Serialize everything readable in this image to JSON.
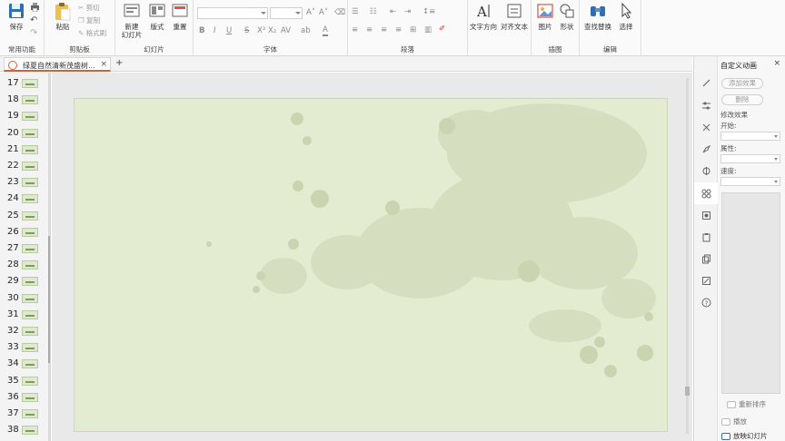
{
  "ribbon": {
    "groups": {
      "common": "常用功能",
      "clipboard": "剪贴板",
      "slides": "幻灯片",
      "font": "字体",
      "paragraph": "段落",
      "illustration": "插图",
      "edit": "编辑"
    },
    "buttons": {
      "save": "保存",
      "paste": "粘贴",
      "cut": "剪切",
      "copy": "复制",
      "format_painter": "格式刷",
      "new_slide_1": "新建",
      "new_slide_2": "幻灯片",
      "layout": "版式",
      "reset": "重置",
      "text_direction": "文字方向",
      "align_text": "对齐文本",
      "picture": "图片",
      "shape": "形状",
      "find_replace": "查找替换",
      "select": "选择"
    },
    "font_buttons": [
      "B",
      "I",
      "U",
      "S",
      "A"
    ],
    "font_size_buttons": [
      "A˄",
      "A˅"
    ]
  },
  "tabs": {
    "document_title": "绿夏自然清新茂盛树...",
    "close": "×",
    "add": "+"
  },
  "thumbnails": [
    "17",
    "18",
    "19",
    "20",
    "21",
    "22",
    "23",
    "24",
    "25",
    "26",
    "27",
    "28",
    "29",
    "30",
    "31",
    "32",
    "33",
    "34",
    "35",
    "36",
    "37",
    "38"
  ],
  "pane": {
    "title": "自定义动画",
    "close": "×",
    "add_effect": "添加效果",
    "delete": "删除",
    "modify": "修改效果",
    "start": "开始:",
    "property": "属性:",
    "speed": "速度:",
    "reorder": "重新排序",
    "play": "播放",
    "slideshow": "放映幻灯片"
  },
  "colors": {
    "slide_bg": "#e3ecd1",
    "accent_tab": "#e45a2e"
  }
}
